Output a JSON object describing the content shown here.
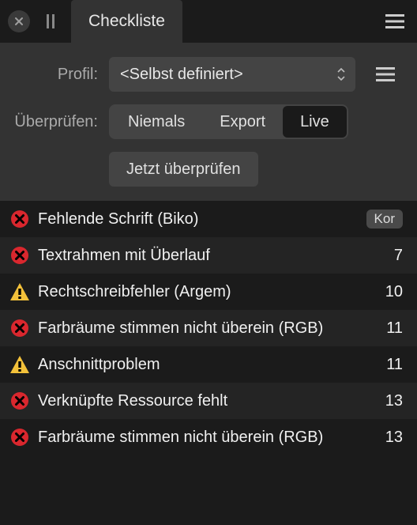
{
  "header": {
    "tab_title": "Checkliste"
  },
  "controls": {
    "profile_label": "Profil:",
    "profile_value": "<Selbst definiert>",
    "check_label": "Überprüfen:",
    "seg_never": "Niemals",
    "seg_export": "Export",
    "seg_live": "Live",
    "check_now": "Jetzt überprüfen"
  },
  "list": [
    {
      "icon": "error",
      "label": "Fehlende Schrift (Biko)",
      "badge": "Kor",
      "count": ""
    },
    {
      "icon": "error",
      "label": "Textrahmen mit Überlauf",
      "badge": "",
      "count": "7"
    },
    {
      "icon": "warning",
      "label": "Rechtschreibfehler (Argem)",
      "badge": "",
      "count": "10"
    },
    {
      "icon": "error",
      "label": "Farbräume stimmen nicht überein (RGB)",
      "badge": "",
      "count": "11"
    },
    {
      "icon": "warning",
      "label": "Anschnittproblem",
      "badge": "",
      "count": "11"
    },
    {
      "icon": "error",
      "label": "Verknüpfte Ressource fehlt",
      "badge": "",
      "count": "13"
    },
    {
      "icon": "error",
      "label": "Farbräume stimmen nicht überein (RGB)",
      "badge": "",
      "count": "13"
    }
  ]
}
